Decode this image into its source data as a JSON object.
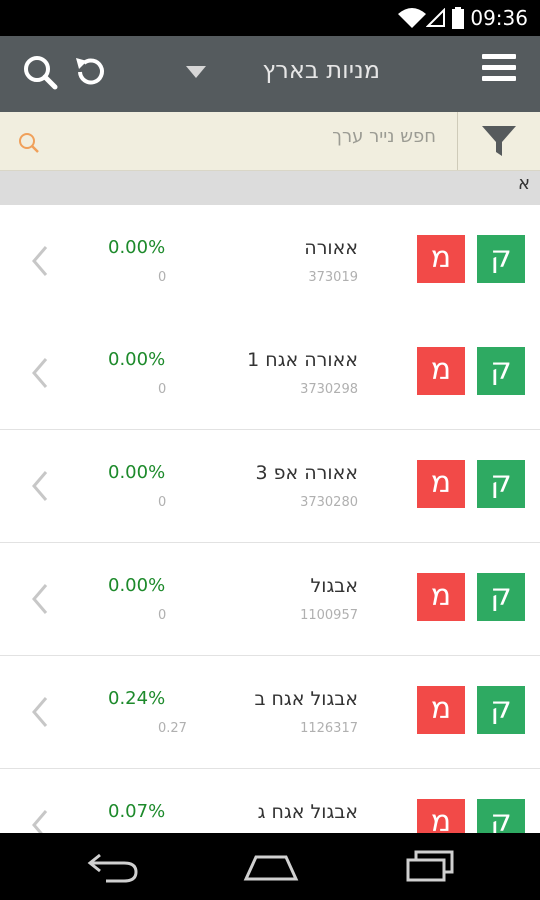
{
  "status_bar": {
    "time": "09:36"
  },
  "app_bar": {
    "title": "מניות בארץ"
  },
  "search": {
    "placeholder": "חפש נייר ערך"
  },
  "section_header": {
    "letter": "א"
  },
  "buttons": {
    "buy_label": "ק",
    "sell_label": "מ"
  },
  "stocks": [
    {
      "name": "אאורה",
      "code": "373019",
      "change": "0.00%",
      "value": "0"
    },
    {
      "name": "אאורה אגח 1",
      "code": "3730298",
      "change": "0.00%",
      "value": "0"
    },
    {
      "name": "אאורה אפ 3",
      "code": "3730280",
      "change": "0.00%",
      "value": "0"
    },
    {
      "name": "אבגול",
      "code": "1100957",
      "change": "0.00%",
      "value": "0"
    },
    {
      "name": "אבגול אגח ב",
      "code": "1126317",
      "change": "0.24%",
      "value": "0.27"
    },
    {
      "name": "אבגול אגח ג",
      "code": "",
      "change": "0.07%",
      "value": ""
    }
  ],
  "colors": {
    "appbar": "#555b5e",
    "searchbar": "#f1eedf",
    "positive": "#1d8a2b",
    "sell": "#f24a48",
    "buy": "#2eaa62"
  }
}
